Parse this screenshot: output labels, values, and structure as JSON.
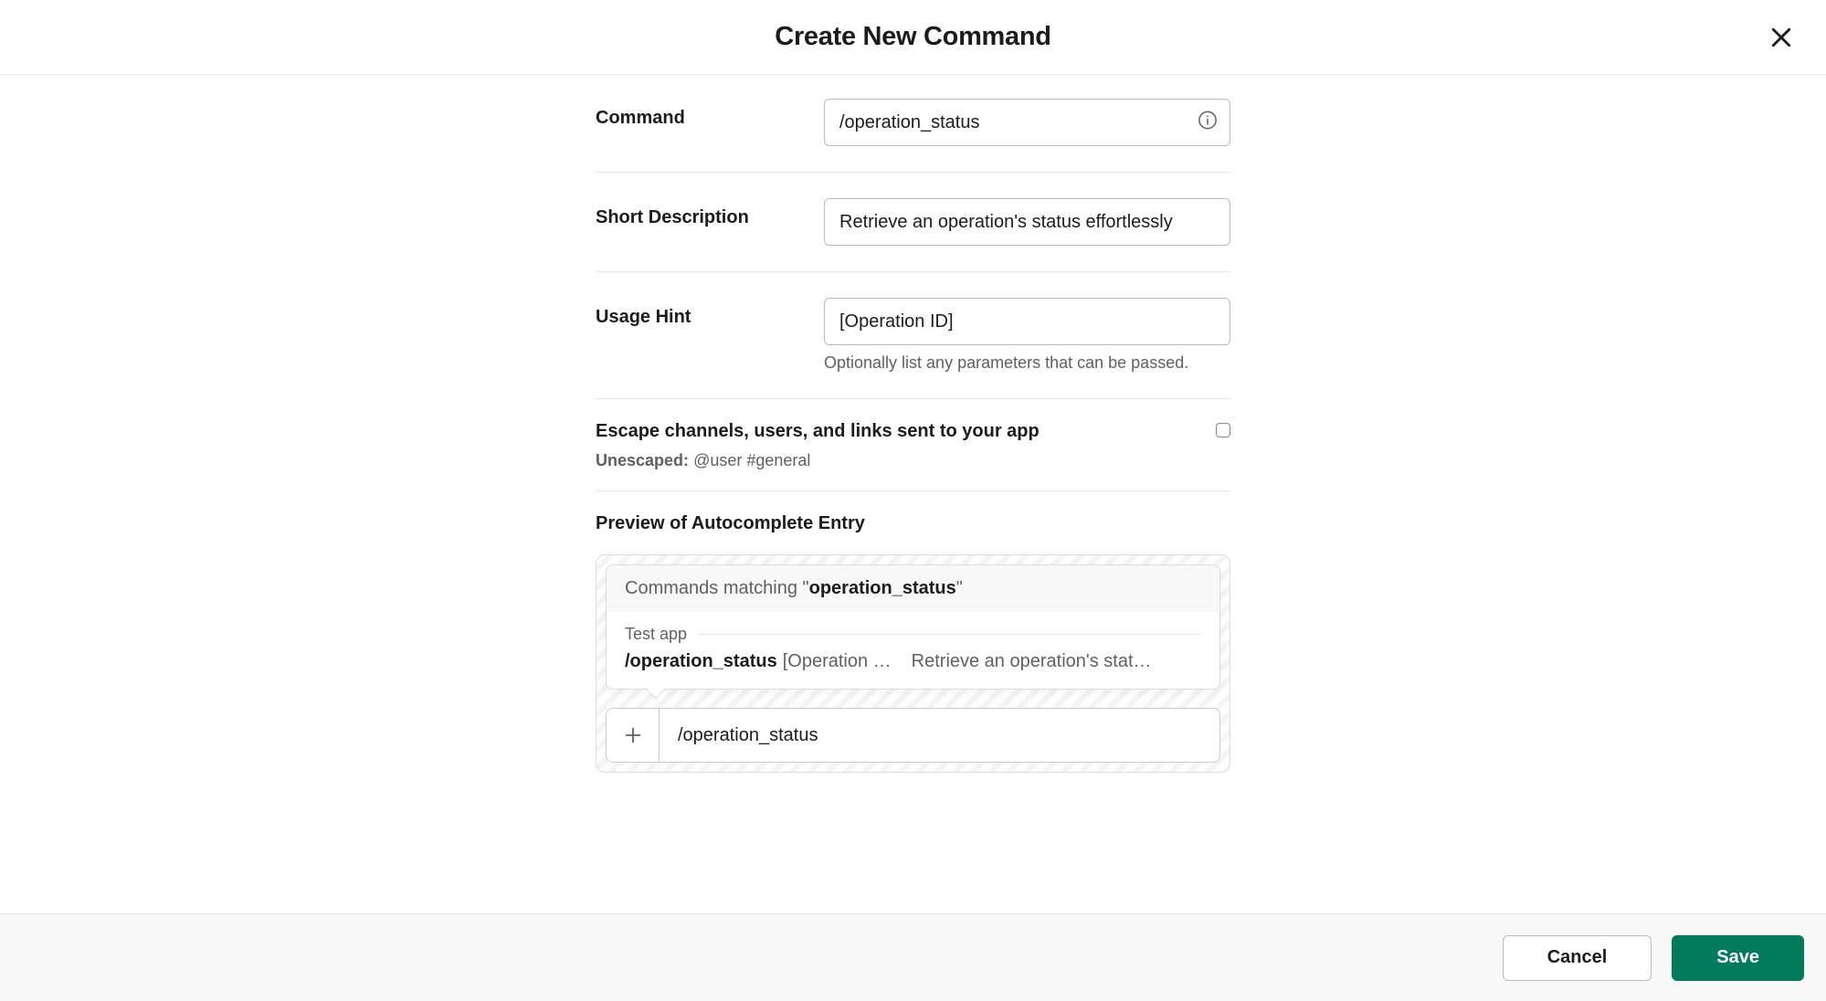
{
  "header": {
    "title": "Create New Command"
  },
  "fields": {
    "command": {
      "label": "Command",
      "value": "/operation_status"
    },
    "short_description": {
      "label": "Short Description",
      "value": "Retrieve an operation's status effortlessly"
    },
    "usage_hint": {
      "label": "Usage Hint",
      "value": "[Operation ID]",
      "helper": "Optionally list any parameters that can be passed."
    },
    "escape": {
      "label": "Escape channels, users, and links sent to your app",
      "sub_prefix": "Unescaped:",
      "sub_value": "@user #general",
      "checked": false
    }
  },
  "preview": {
    "title": "Preview of Autocomplete Entry",
    "matching_prefix": "Commands matching \"",
    "matching_term": "operation_status",
    "matching_suffix": "\"",
    "app_name": "Test app",
    "command_name": "/operation_status",
    "command_hint": "[Operation …",
    "command_desc": "Retrieve an operation's stat…",
    "input_text": "/operation_status"
  },
  "footer": {
    "cancel": "Cancel",
    "save": "Save"
  }
}
